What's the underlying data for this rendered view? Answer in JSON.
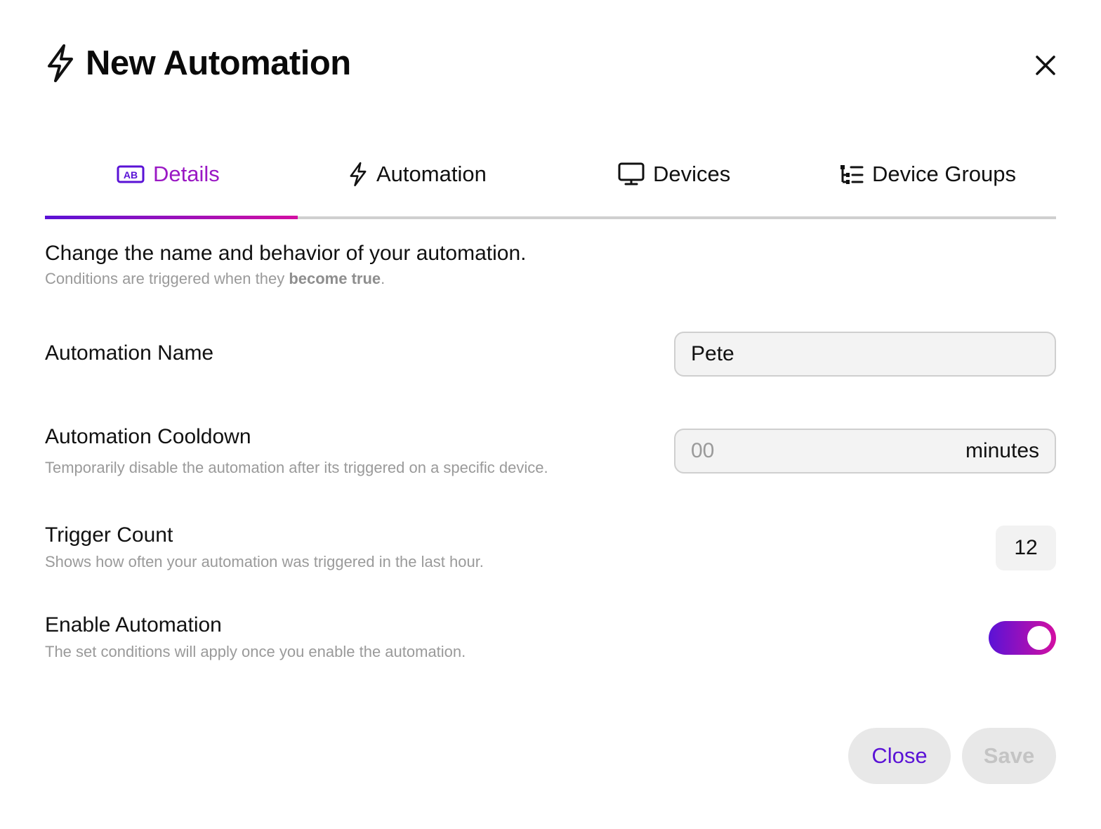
{
  "header": {
    "title": "New Automation",
    "icon": "bolt-icon"
  },
  "tabs": [
    {
      "label": "Details",
      "icon": "ab-text-icon",
      "active": true
    },
    {
      "label": "Automation",
      "icon": "bolt-icon",
      "active": false
    },
    {
      "label": "Devices",
      "icon": "monitor-icon",
      "active": false
    },
    {
      "label": "Device Groups",
      "icon": "tree-list-icon",
      "active": false
    }
  ],
  "intro": {
    "title": "Change the name and behavior of your automation.",
    "sub_prefix": "Conditions are triggered when they ",
    "sub_bold": "become true",
    "sub_suffix": "."
  },
  "fields": {
    "name": {
      "label": "Automation Name",
      "value": "Pete"
    },
    "cooldown": {
      "label": "Automation Cooldown",
      "description": "Temporarily disable the automation after its triggered on a specific device.",
      "placeholder": "00",
      "unit": "minutes"
    },
    "trigger_count": {
      "label": "Trigger Count",
      "description": "Shows how often your automation was triggered in the last hour.",
      "value": "12"
    },
    "enable": {
      "label": "Enable Automation",
      "description": "The set conditions will apply once you enable the automation.",
      "enabled": true
    }
  },
  "buttons": {
    "close": "Close",
    "save": "Save"
  },
  "colors": {
    "accent_start": "#5a12d6",
    "accent_end": "#d30fa2",
    "active_tab": "#9a18c4"
  }
}
